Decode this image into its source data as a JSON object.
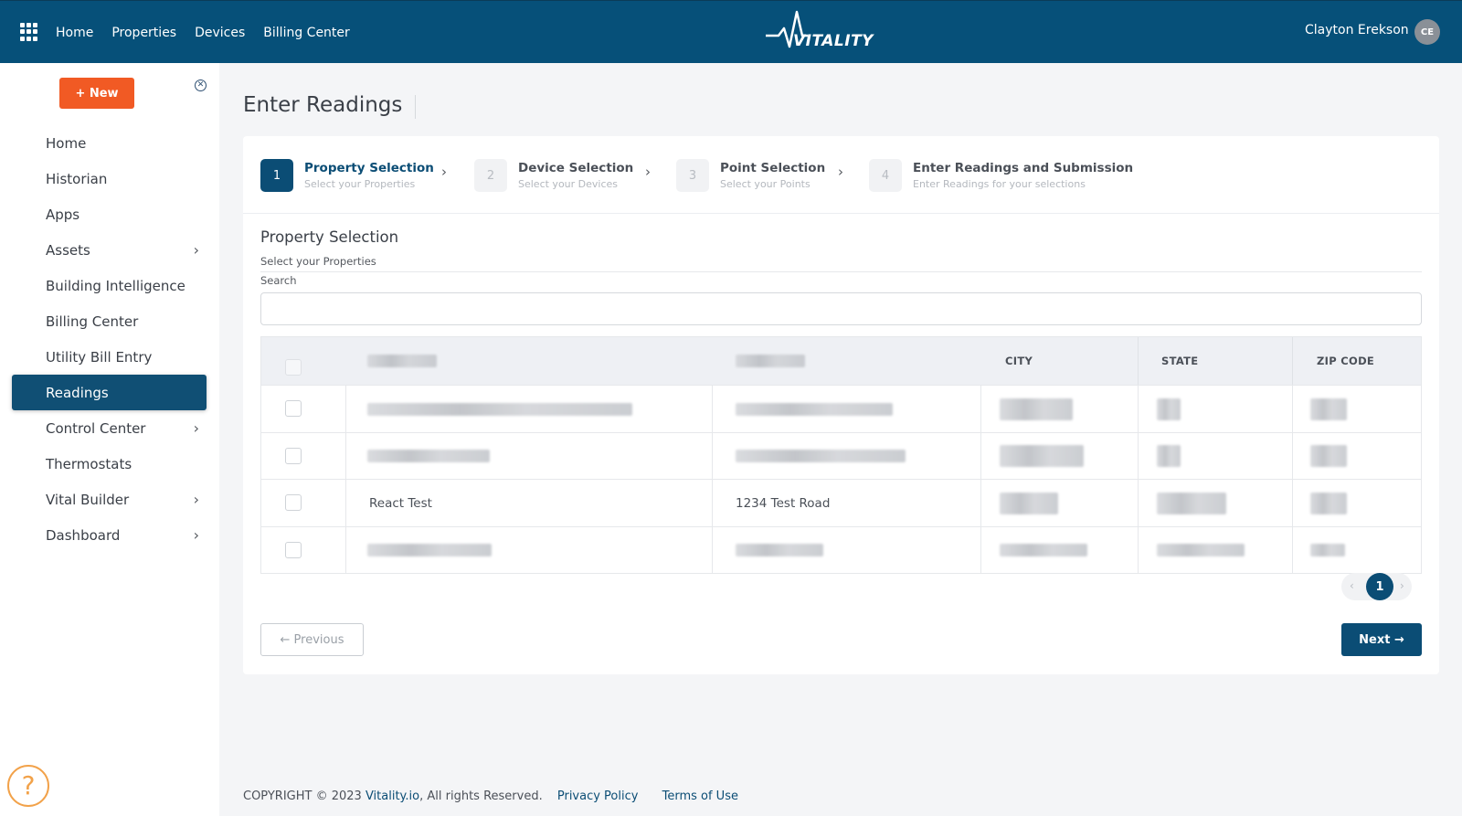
{
  "topbar": {
    "nav": [
      "Home",
      "Properties",
      "Devices",
      "Billing Center"
    ],
    "logo_text": "VITALITY",
    "user_name": "Clayton Erekson",
    "user_initials": "CE",
    "icon_apps": "grid-icon",
    "brand_color": "#065079"
  },
  "sidebar": {
    "new_button": "+ New",
    "items": [
      {
        "label": "Home",
        "has_children": false
      },
      {
        "label": "Historian",
        "has_children": false
      },
      {
        "label": "Apps",
        "has_children": false
      },
      {
        "label": "Assets",
        "has_children": true
      },
      {
        "label": "Building Intelligence",
        "has_children": false
      },
      {
        "label": "Billing Center",
        "has_children": false
      },
      {
        "label": "Utility Bill Entry",
        "has_children": false
      },
      {
        "label": "Readings",
        "has_children": false,
        "active": true
      },
      {
        "label": "Control Center",
        "has_children": true
      },
      {
        "label": "Thermostats",
        "has_children": false
      },
      {
        "label": "Vital Builder",
        "has_children": true
      },
      {
        "label": "Dashboard",
        "has_children": true
      }
    ],
    "help_icon": "?"
  },
  "main": {
    "page_title": "Enter Readings",
    "steps": [
      {
        "num": "1",
        "title": "Property Selection",
        "subtitle": "Select your Properties",
        "active": true
      },
      {
        "num": "2",
        "title": "Device Selection",
        "subtitle": "Select your Devices",
        "active": false
      },
      {
        "num": "3",
        "title": "Point Selection",
        "subtitle": "Select your Points",
        "active": false
      },
      {
        "num": "4",
        "title": "Enter Readings and Submission",
        "subtitle": "Enter Readings for your selections",
        "active": false
      }
    ],
    "section_title": "Property Selection",
    "section_subtitle": "Select your Properties",
    "search_label": "Search",
    "search_value": "",
    "table": {
      "headers": [
        "",
        "",
        "CITY",
        "STATE",
        "ZIP CODE"
      ],
      "rows": [
        {
          "name": "",
          "address": "",
          "city": "",
          "state": "",
          "zip": "",
          "redacted": true
        },
        {
          "name": "",
          "address": "",
          "city": "",
          "state": "",
          "zip": "",
          "redacted": true
        },
        {
          "name": "React Test",
          "address": "1234 Test Road",
          "city": "",
          "state": "",
          "zip": "",
          "redacted": false
        },
        {
          "name": "",
          "address": "",
          "city": "",
          "state": "",
          "zip": "",
          "redacted": true
        }
      ]
    },
    "pagination": {
      "prev": "‹",
      "current": "1",
      "next": "›"
    },
    "prev_button": "← Previous",
    "next_button": "Next →"
  },
  "footer": {
    "copyright": "COPYRIGHT © 2023 ",
    "brand_link": "Vitality.io",
    "rights": ", All rights Reserved.",
    "privacy": "Privacy Policy",
    "terms": "Terms of Use"
  }
}
